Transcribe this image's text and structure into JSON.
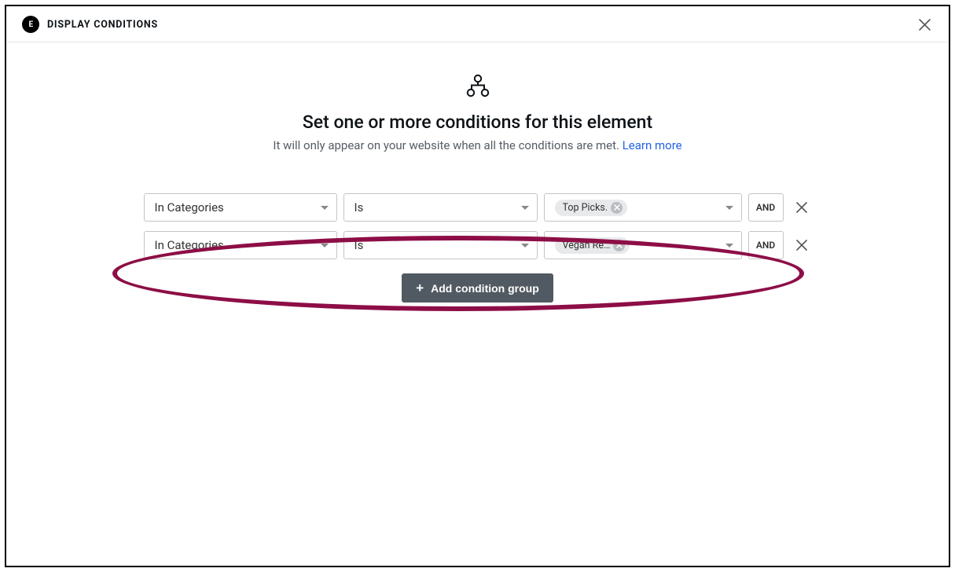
{
  "header": {
    "logo_text": "E",
    "title": "DISPLAY CONDITIONS"
  },
  "hero": {
    "title": "Set one or more conditions for this element",
    "subtitle": "It will only appear on your website when all the conditions are met. ",
    "learn_more": "Learn more"
  },
  "conditions": [
    {
      "field": "In Categories",
      "operator": "Is",
      "value_tag": "Top Picks.",
      "logic": "AND"
    },
    {
      "field": "In Categories",
      "operator": "Is",
      "value_tag": "Vegan Re…",
      "logic": "AND"
    }
  ],
  "add_group_label": "Add condition group"
}
